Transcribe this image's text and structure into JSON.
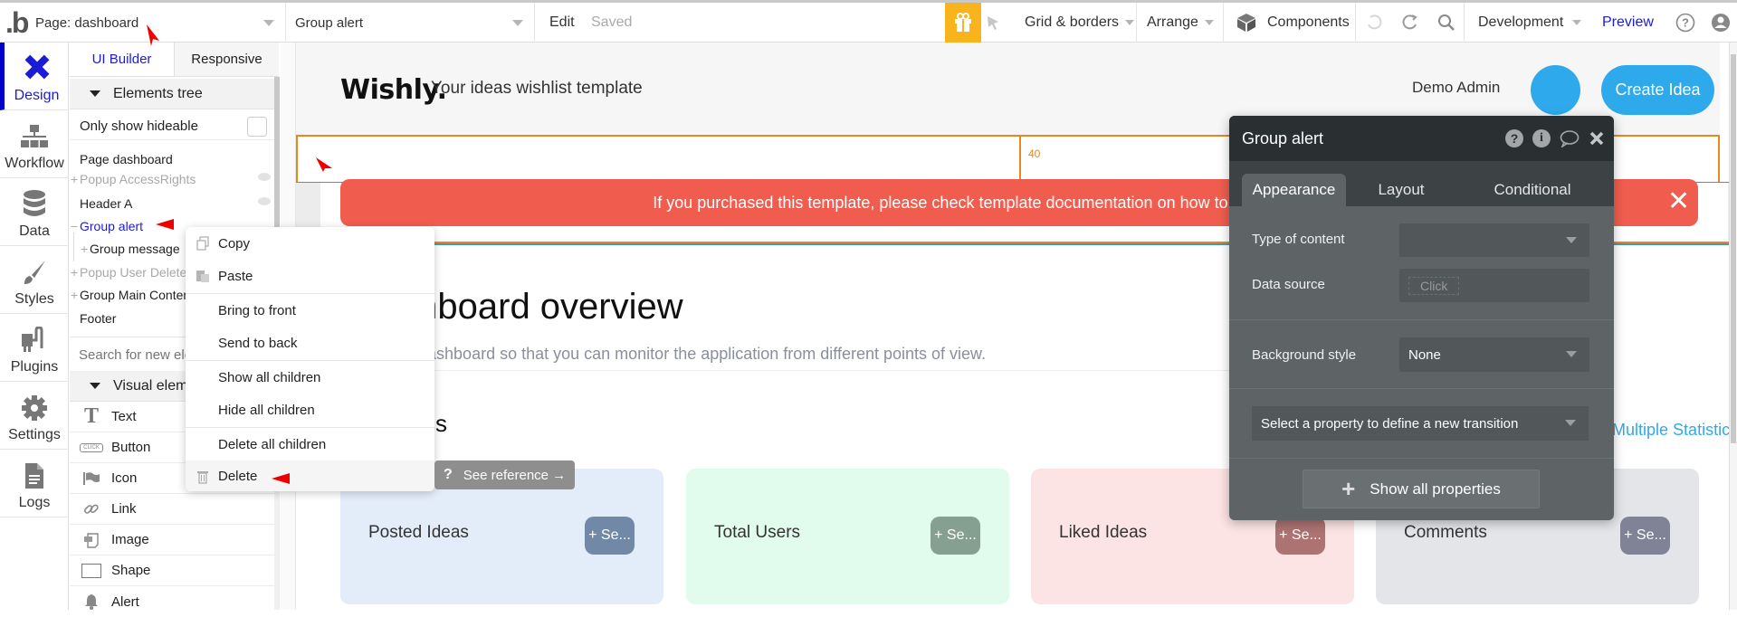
{
  "topbar": {
    "logo": ".b",
    "page_selector": "Page: dashboard",
    "element_selector": "Group alert",
    "edit_label": "Edit",
    "saved_label": "Saved",
    "gift_icon": "gift-icon",
    "grid_borders_label": "Grid & borders",
    "arrange_label": "Arrange",
    "components_label": "Components",
    "development_label": "Development",
    "preview_label": "Preview"
  },
  "rail": {
    "items": [
      {
        "label": "Design",
        "icon": "design-icon",
        "active": true
      },
      {
        "label": "Workflow",
        "icon": "workflow-icon"
      },
      {
        "label": "Data",
        "icon": "data-icon"
      },
      {
        "label": "Styles",
        "icon": "styles-icon"
      },
      {
        "label": "Plugins",
        "icon": "plugins-icon"
      },
      {
        "label": "Settings",
        "icon": "settings-icon"
      },
      {
        "label": "Logs",
        "icon": "logs-icon"
      }
    ]
  },
  "panel": {
    "tabs": [
      "UI Builder",
      "Responsive"
    ],
    "elements_tree_title": "Elements tree",
    "only_show_hideable": "Only show hideable",
    "tree": [
      {
        "label": "Page dashboard",
        "prefix": ""
      },
      {
        "label": "Popup AccessRights",
        "prefix": "+",
        "muted": true
      },
      {
        "label": "Header A",
        "prefix": ""
      },
      {
        "label": "Group alert",
        "prefix": "−",
        "selected": true
      },
      {
        "label": "Group message",
        "prefix": "+"
      },
      {
        "label": "Popup User Delete",
        "prefix": "+",
        "muted": true
      },
      {
        "label": "Group Main Content",
        "prefix": "+"
      },
      {
        "label": "Footer",
        "prefix": ""
      }
    ],
    "search_placeholder": "Search for new elements...",
    "visual_elements_title": "Visual elements",
    "visual_elements": [
      {
        "label": "Text",
        "icon": "text-icon"
      },
      {
        "label": "Button",
        "icon": "button-icon"
      },
      {
        "label": "Icon",
        "icon": "flag-icon"
      },
      {
        "label": "Link",
        "icon": "link-icon"
      },
      {
        "label": "Image",
        "icon": "image-icon"
      },
      {
        "label": "Shape",
        "icon": "shape-icon"
      },
      {
        "label": "Alert",
        "icon": "bell-icon"
      }
    ]
  },
  "context_menu": {
    "items": [
      "Copy",
      "Paste",
      "Bring to front",
      "Send to back",
      "Show all children",
      "Hide all children",
      "Delete all children",
      "Delete"
    ]
  },
  "see_reference": "See reference →",
  "canvas": {
    "brand": "Wishly.",
    "tagline": "Your ideas wishlist template",
    "user_name": "Demo Admin",
    "create_idea": "Create Idea",
    "group_height_label": "40",
    "alert_text": "If you purchased this template, please check template documentation on how to enable admin access",
    "alert_close": "✕",
    "overview_title": "Dashboard overview",
    "overview_subtitle": "Platform dashboard so that you can monitor the application from different points of view.",
    "stats_title": "Statistics",
    "stats_link": "See Multiple Statistics",
    "cards": [
      {
        "title": "Posted Ideas",
        "button": "+ Se...",
        "bg": "#e3ecf9",
        "btn": "#7189a6"
      },
      {
        "title": "Total Users",
        "button": "+ Se...",
        "bg": "#e1fbec",
        "btn": "#86a08f"
      },
      {
        "title": "Liked Ideas",
        "button": "+ Se...",
        "bg": "#fde4e4",
        "btn": "#ad7272"
      },
      {
        "title": "Comments",
        "button": "+ Se...",
        "bg": "#e4e5e9",
        "btn": "#7f8395"
      }
    ]
  },
  "property_panel": {
    "title": "Group alert",
    "tabs": [
      "Appearance",
      "Layout",
      "Conditional"
    ],
    "type_of_content_label": "Type of content",
    "type_of_content_value": "",
    "data_source_label": "Data source",
    "data_source_placeholder": "Click",
    "background_style_label": "Background style",
    "background_style_value": "None",
    "transition_placeholder": "Select a property to define a new transition",
    "show_all_properties": "Show all properties"
  },
  "colors": {
    "accent": "#1b1bd6",
    "brand_blue": "#2eaaec",
    "alert_red": "#f05d4e",
    "gift_orange": "#f9b31c",
    "selection_orange": "#e48a1a"
  }
}
